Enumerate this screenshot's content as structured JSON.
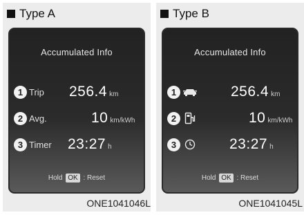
{
  "type_a": {
    "header": "Type A",
    "title": "Accumulated Info",
    "rows": [
      {
        "index": "1",
        "label": "Trip",
        "value": "256.4",
        "unit": "km"
      },
      {
        "index": "2",
        "label": "Avg.",
        "value": "10",
        "unit": "km/kWh"
      },
      {
        "index": "3",
        "label": "Timer",
        "value": "23:27",
        "unit": "h"
      }
    ],
    "hint_prefix": "Hold",
    "hint_key": "OK",
    "hint_suffix": ": Reset",
    "code": "ONE1041046L"
  },
  "type_b": {
    "header": "Type B",
    "title": "Accumulated Info",
    "rows": [
      {
        "index": "1",
        "icon": "car-trip-icon",
        "value": "256.4",
        "unit": "km"
      },
      {
        "index": "2",
        "icon": "charging-station-icon",
        "value": "10",
        "unit": "km/kWh"
      },
      {
        "index": "3",
        "icon": "clock-icon",
        "value": "23:27",
        "unit": "h"
      }
    ],
    "hint_prefix": "Hold",
    "hint_key": "OK",
    "hint_suffix": ": Reset",
    "code": "ONE1041045L"
  }
}
